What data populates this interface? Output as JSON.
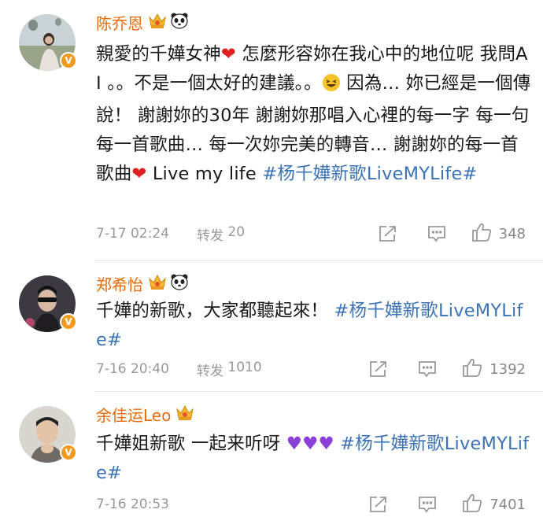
{
  "comments": [
    {
      "username": "陈乔恩",
      "verified_mark": "V",
      "text_1": "親愛的千嬅女神",
      "text_2": " 怎麼形容妳在我心中的地位呢 我問AI 。。不是一個太好的建議。。",
      "text_3": " 因為… 妳已經是一個傳說！ 謝謝妳的30年 謝謝妳那唱入心裡的每一字 每一句 每一首歌曲… 每一次妳完美的轉音… 謝謝妳的每一首歌曲",
      "text_4": " Live my life ",
      "topic": "#杨千嬅新歌LiveMYLife#",
      "time": "7-17 02:24",
      "repost_label": "转发",
      "repost_count": "20",
      "likes": "348",
      "emojis": [
        "red-heart",
        "laughing-face",
        "red-heart"
      ],
      "badges": [
        "crown",
        "panda"
      ]
    },
    {
      "username": "郑希怡",
      "verified_mark": "V",
      "text_1": "千嬅的新歌，大家都聽起來！ ",
      "topic": "#杨千嬅新歌LiveMYLife#",
      "time": "7-16 20:40",
      "repost_label": "转发",
      "repost_count": "1010",
      "likes": "1392",
      "badges": [
        "crown",
        "panda"
      ]
    },
    {
      "username": "余佳运Leo",
      "verified_mark": "V",
      "text_1": "千嬅姐新歌 一起来听呀",
      "topic": "#杨千嬅新歌LiveMYLife#",
      "time": "7-16 20:53",
      "likes": "7401",
      "emojis": [
        "purple-heart",
        "purple-heart",
        "purple-heart"
      ],
      "badges": [
        "crown"
      ]
    }
  ],
  "colors": {
    "username": "#e86b0c",
    "topic": "#3b73b5",
    "meta": "#999999",
    "verified": "#f39a1e"
  },
  "icons": [
    "share-icon",
    "comment-icon",
    "like-icon",
    "crown-icon",
    "panda-icon"
  ]
}
